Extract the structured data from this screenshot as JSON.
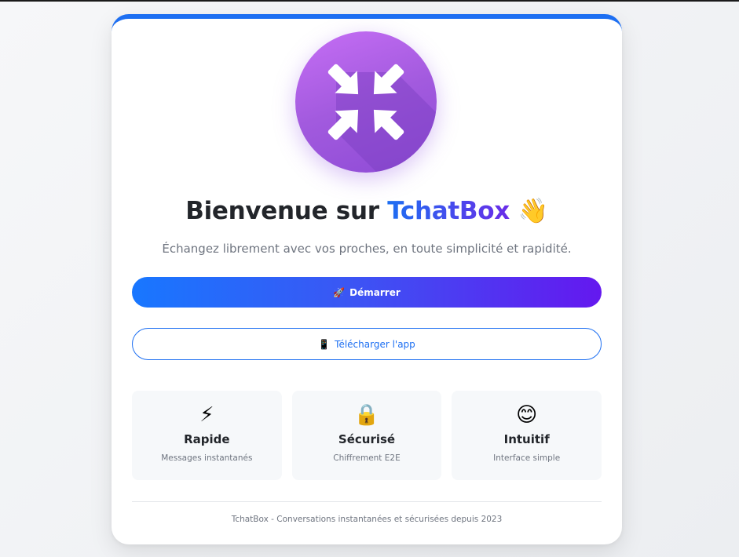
{
  "hero": {
    "logo_icon": "compress-arrows-icon",
    "title_prefix": "Bienvenue sur",
    "brand_name": "TchatBox",
    "title_emoji": "👋",
    "subtitle": "Échangez librement avec vos proches, en toute simplicité et rapidité."
  },
  "actions": {
    "start": {
      "icon": "🚀",
      "label": "Démarrer"
    },
    "download": {
      "icon": "📱",
      "label": "Télécharger l'app"
    }
  },
  "features": [
    {
      "icon": "⚡",
      "icon_name": "lightning-icon",
      "title": "Rapide",
      "description": "Messages instantanés"
    },
    {
      "icon": "🔒",
      "icon_name": "lock-icon",
      "title": "Sécurisé",
      "description": "Chiffrement E2E"
    },
    {
      "icon": "😊",
      "icon_name": "smile-icon",
      "title": "Intuitif",
      "description": "Interface simple"
    }
  ],
  "footer": {
    "text": "TchatBox - Conversations instantanées et sécurisées depuis 2023"
  },
  "colors": {
    "accent": "#1d6ff2",
    "gradient_end": "#6418ef",
    "logo_purple": "#a25ade"
  }
}
